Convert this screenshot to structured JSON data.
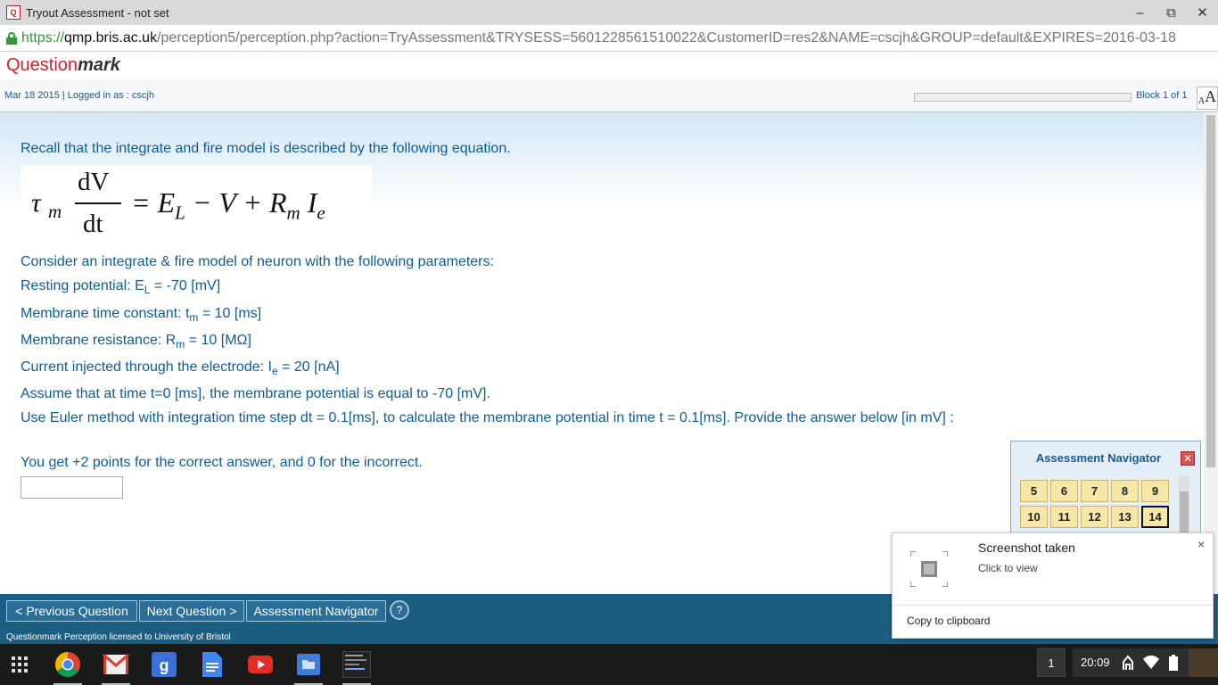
{
  "window": {
    "title": "Tryout Assessment - not set",
    "minimize": "–",
    "restore": "⧉",
    "close": "✕"
  },
  "address": {
    "scheme": "https://",
    "host": "qmp.bris.ac.uk",
    "path": "/perception5/perception.php?action=TryAssessment&TRYSESS=5601228561510022&CustomerID=res2&NAME=cscjh&GROUP=default&EXPIRES=2016-03-18"
  },
  "logo": {
    "part1": "Question",
    "part2": "mark"
  },
  "status": {
    "date_login": "Mar 18 2015 | Logged in as : cscjh",
    "block": "Block 1 of 1",
    "font_small": "A",
    "font_large": "A"
  },
  "question": {
    "intro": "Recall that the integrate and fire model is described by the following equation.",
    "equation": {
      "tau": "τ",
      "tau_sub": "m",
      "numerator": "dV",
      "denominator": "dt",
      "rhs_eq": "= E",
      "rhs_L": "L",
      "rhs_mid": " − V + R",
      "rhs_m": "m",
      "rhs_I": " I",
      "rhs_e": "e"
    },
    "consider": "Consider an integrate & fire model of neuron with the following parameters:",
    "resting_a": "Resting potential: E",
    "resting_sub": "L",
    "resting_b": " = -70 [mV]",
    "time_const_a": "Membrane time constant: t",
    "time_const_sub": "m",
    "time_const_b": " = 10 [ms]",
    "resistance_a": "Membrane resistance: R",
    "resistance_sub": "m",
    "resistance_b": " = 10 [MΩ]",
    "current_a": "Current injected through the electrode: I",
    "current_sub": "e",
    "current_b": " = 20 [nA]",
    "assume": "Assume that at time t=0 [ms], the membrane potential is equal to -70 [mV].",
    "euler": "Use Euler method with integration time step dt = 0.1[ms], to calculate the membrane potential in time t = 0.1[ms]. Provide the answer below [in mV] :",
    "points": "You get +2 points for the correct answer, and 0 for the incorrect.",
    "answer_value": ""
  },
  "navigator": {
    "title": "Assessment Navigator",
    "close": "✕",
    "row1": [
      "5",
      "6",
      "7",
      "8",
      "9"
    ],
    "row2": [
      "10",
      "11",
      "12",
      "13",
      "14"
    ],
    "current": "14"
  },
  "toolbar": {
    "prev": "< Previous Question",
    "next": "Next Question >",
    "navigator": "Assessment Navigator",
    "help": "?",
    "license": "Questionmark Perception licensed to University of Bristol"
  },
  "notification": {
    "title": "Screenshot taken",
    "subtitle": "Click to view",
    "action": "Copy to clipboard",
    "close": "×"
  },
  "taskbar": {
    "apps": [
      "launcher-icon",
      "chrome-icon",
      "gmail-icon",
      "google-search-icon",
      "docs-icon",
      "youtube-icon",
      "files-icon",
      "terminal-thumbnail-icon"
    ],
    "window_count": "1",
    "time": "20:09"
  },
  "colors": {
    "accent": "#0d5c9a",
    "toolbar": "#1c5d82",
    "nav_cell": "#f6e7a8",
    "brand_red": "#d4202a"
  }
}
